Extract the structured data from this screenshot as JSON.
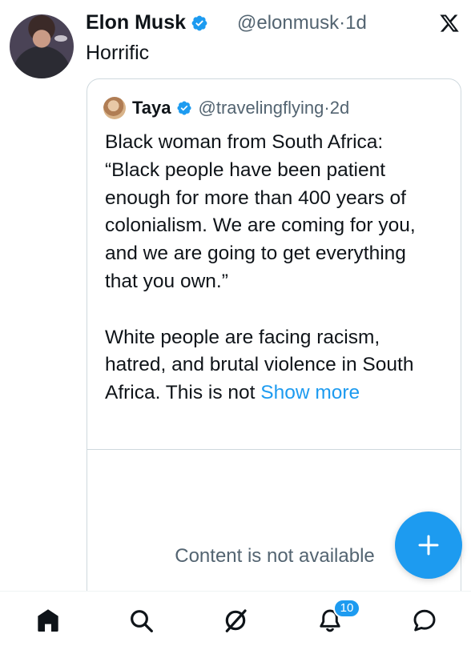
{
  "post": {
    "author_name": "Elon Musk",
    "handle": "@elonmusk",
    "time_sep": "·",
    "time": "1d",
    "text": "Horrific",
    "icons": {
      "avatar": "elon-avatar",
      "verified": "verified-badge-icon",
      "platform": "x-logo-icon"
    }
  },
  "quoted_post": {
    "author_name": "Taya",
    "handle": "@travelingflying",
    "time_sep": "·",
    "time": "2d",
    "paragraph1": "Black woman from South Africa: “Black people have been patient enough for more than 400 years of colonialism. We are coming for you, and we are going to get everything that you own.”",
    "paragraph2": "White people are facing racism, hatred, and brutal violence in South Africa. This is not",
    "show_more": "Show more",
    "media_unavailable": "Content is not available"
  },
  "fab": {
    "icon": "plus-icon"
  },
  "bottom_nav": {
    "items": [
      "home-icon",
      "search-icon",
      "grok-icon",
      "notifications-icon",
      "messages-icon"
    ],
    "notifications_count": "10"
  },
  "colors": {
    "accent": "#1d9bf0",
    "text": "#0f1419",
    "muted": "#536471",
    "border": "#cfd9de"
  }
}
